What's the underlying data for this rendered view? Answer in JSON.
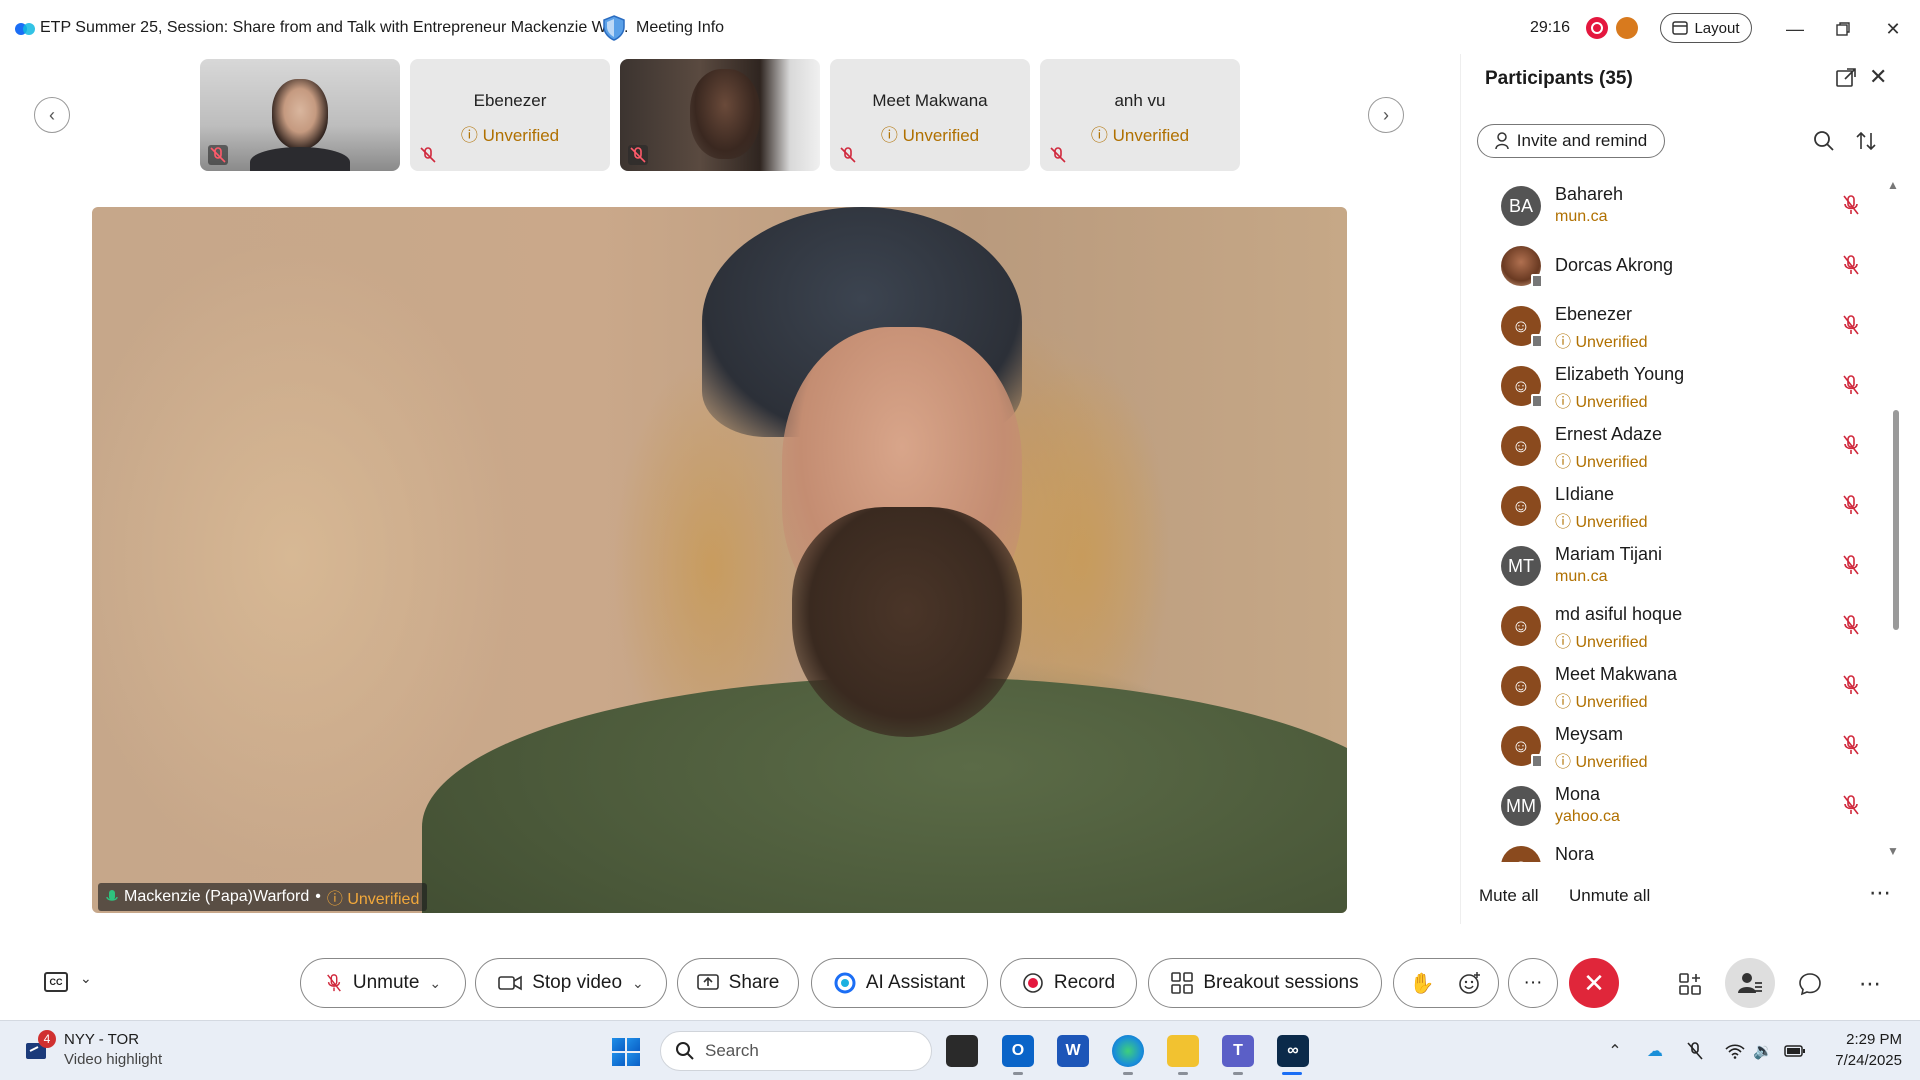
{
  "window": {
    "title": "ETP Summer 25, Session: Share from and Talk with Entrepreneur Mackenzie Wa...",
    "meeting_info": "Meeting Info",
    "timer": "29:16",
    "layout_label": "Layout"
  },
  "thumbnails": [
    {
      "name": "",
      "status": "",
      "has_video": true
    },
    {
      "name": "Ebenezer",
      "status": "Unverified",
      "has_video": false
    },
    {
      "name": "",
      "status": "",
      "has_video": true
    },
    {
      "name": "Meet Makwana",
      "status": "Unverified",
      "has_video": false
    },
    {
      "name": "anh vu",
      "status": "Unverified",
      "has_video": false
    }
  ],
  "main_video": {
    "speaker_name": "Mackenzie (Papa)Warford",
    "separator": "•",
    "speaker_status": "Unverified"
  },
  "participants_panel": {
    "title": "Participants (35)",
    "invite_label": "Invite and remind",
    "mute_all_label": "Mute all",
    "unmute_all_label": "Unmute all",
    "items": [
      {
        "name": "Bahareh",
        "sub": "mun.ca",
        "avatar": "BA",
        "avatar_type": "initials"
      },
      {
        "name": "Dorcas Akrong",
        "sub": "",
        "avatar": "",
        "avatar_type": "photo"
      },
      {
        "name": "Ebenezer",
        "sub": "Unverified",
        "avatar": "",
        "avatar_type": "guest"
      },
      {
        "name": "Elizabeth Young",
        "sub": "Unverified",
        "avatar": "",
        "avatar_type": "guest"
      },
      {
        "name": "Ernest Adaze",
        "sub": "Unverified",
        "avatar": "",
        "avatar_type": "guest"
      },
      {
        "name": "LIdiane",
        "sub": "Unverified",
        "avatar": "",
        "avatar_type": "guest"
      },
      {
        "name": "Mariam Tijani",
        "sub": "mun.ca",
        "avatar": "MT",
        "avatar_type": "initials"
      },
      {
        "name": "md asiful hoque",
        "sub": "Unverified",
        "avatar": "",
        "avatar_type": "guest"
      },
      {
        "name": "Meet Makwana",
        "sub": "Unverified",
        "avatar": "",
        "avatar_type": "guest"
      },
      {
        "name": "Meysam",
        "sub": "Unverified",
        "avatar": "",
        "avatar_type": "guest"
      },
      {
        "name": "Mona",
        "sub": "yahoo.ca",
        "avatar": "MM",
        "avatar_type": "initials"
      },
      {
        "name": "Nora",
        "sub": "",
        "avatar": "",
        "avatar_type": "guest"
      }
    ]
  },
  "toolbar": {
    "cc_label": "CC",
    "unmute_label": "Unmute",
    "stop_video_label": "Stop video",
    "share_label": "Share",
    "ai_assistant_label": "AI Assistant",
    "record_label": "Record",
    "breakout_label": "Breakout sessions",
    "more_label": "···"
  },
  "taskbar": {
    "weather_badge": "4",
    "weather_title": "NYY - TOR",
    "weather_sub": "Video highlight",
    "search_placeholder": "Search",
    "time": "2:29 PM",
    "date": "7/24/2025"
  },
  "colors": {
    "unverified": "#b07000",
    "end_call": "#e0263a",
    "record": "#e4173e",
    "muted_mic": "#d0283c"
  }
}
